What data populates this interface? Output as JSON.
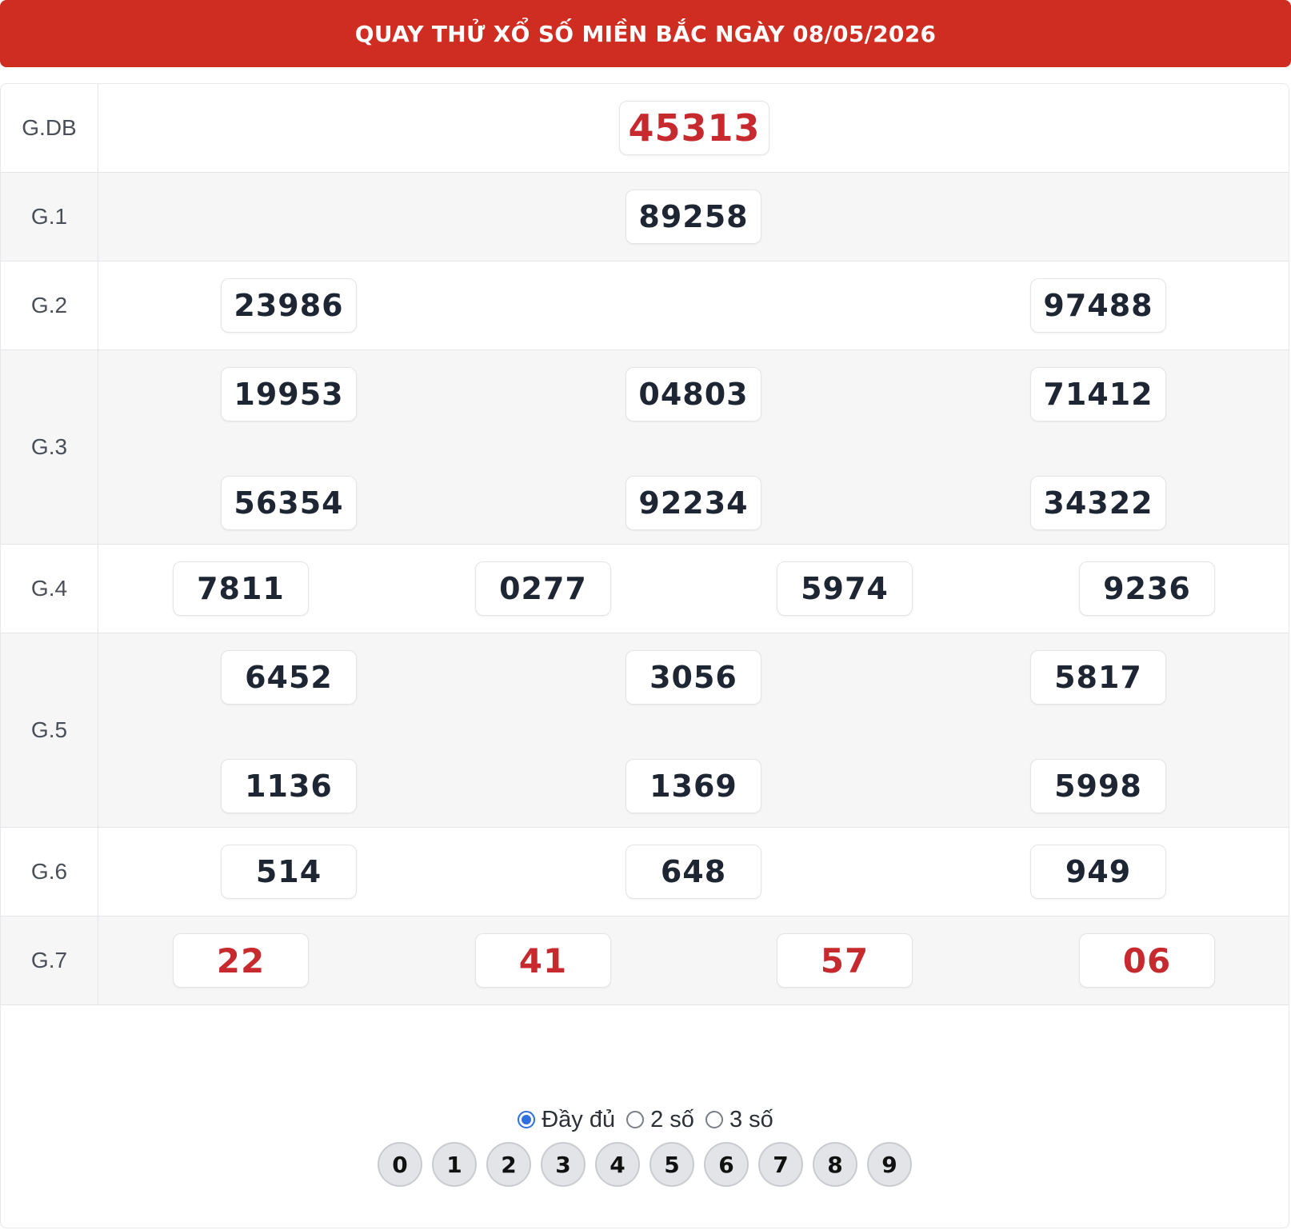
{
  "header": {
    "title": "QUAY THỬ XỔ SỐ MIỀN BẮC NGÀY 08/05/2026"
  },
  "prizes": [
    {
      "label": "G.DB",
      "numbers": [
        "45313"
      ]
    },
    {
      "label": "G.1",
      "numbers": [
        "89258"
      ]
    },
    {
      "label": "G.2",
      "numbers": [
        "23986",
        "97488"
      ]
    },
    {
      "label": "G.3",
      "numbers": [
        "19953",
        "04803",
        "71412",
        "56354",
        "92234",
        "34322"
      ]
    },
    {
      "label": "G.4",
      "numbers": [
        "7811",
        "0277",
        "5974",
        "9236"
      ]
    },
    {
      "label": "G.5",
      "numbers": [
        "6452",
        "3056",
        "5817",
        "1136",
        "1369",
        "5998"
      ]
    },
    {
      "label": "G.6",
      "numbers": [
        "514",
        "648",
        "949"
      ]
    },
    {
      "label": "G.7",
      "numbers": [
        "22",
        "41",
        "57",
        "06"
      ]
    }
  ],
  "display_options": [
    {
      "label": "Đầy đủ",
      "checked": true
    },
    {
      "label": "2 số",
      "checked": false
    },
    {
      "label": "3 số",
      "checked": false
    }
  ],
  "digit_buttons": [
    "0",
    "1",
    "2",
    "3",
    "4",
    "5",
    "6",
    "7",
    "8",
    "9"
  ],
  "colors": {
    "header_bg": "#cf2d22",
    "highlight_number": "#c62a2f",
    "radio_accent": "#2f6fe0"
  }
}
